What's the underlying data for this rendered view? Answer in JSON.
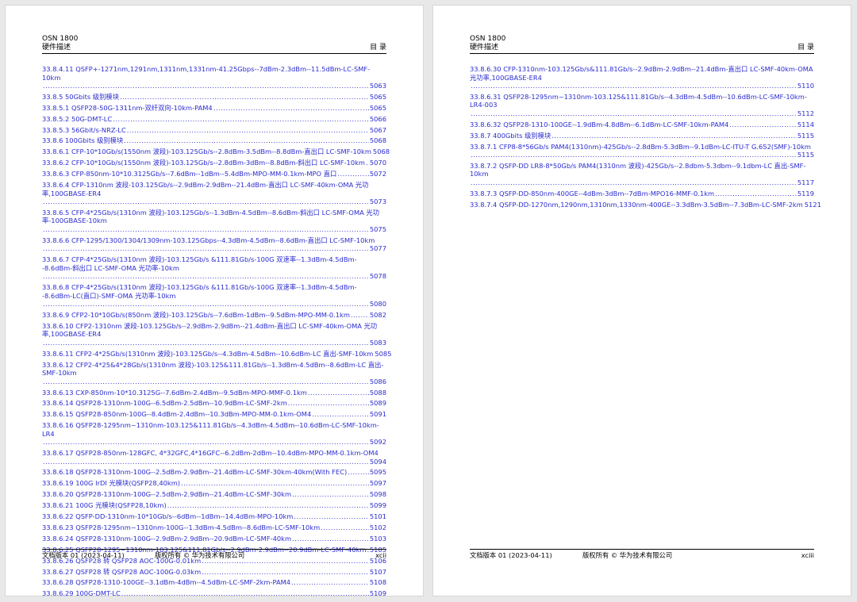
{
  "product": "OSN 1800",
  "doc_title": "硬件描述",
  "section": "目 录",
  "footer": {
    "version": "文档版本 01 (2023-04-11)",
    "copyright": "版权所有 © 华为技术有限公司"
  },
  "pages": [
    {
      "number": "xcii",
      "entries": [
        {
          "text": "33.8.4.11 QSFP+-1271nm,1291nm,1311nm,1331nm-41.25Gbps--7dBm-2.3dBm--11.5dBm-LC-SMF-10km",
          "page": "5063",
          "wrap": true
        },
        {
          "text": "33.8.5 50Gbits 级别模块",
          "page": "5065"
        },
        {
          "text": "33.8.5.1 QSFP28-50G-1311nm-双纤双向-10km-PAM4",
          "page": "5065"
        },
        {
          "text": "33.8.5.2 50G-DMT-LC",
          "page": "5066"
        },
        {
          "text": "33.8.5.3 56Gbit/s-NRZ-LC",
          "page": "5067"
        },
        {
          "text": "33.8.6 100Gbits 级别模块",
          "page": "5068"
        },
        {
          "text": "33.8.6.1 CFP-10*10Gb/s(1550nm 波段)-103.125Gb/s--2.8dBm-3.5dBm--8.8dBm-直出口 LC-SMF-10km",
          "page": "5068"
        },
        {
          "text": "33.8.6.2 CFP-10*10Gb/s(1550nm 波段)-103.125Gb/s--2.8dBm-3dBm--8.8dBm-斜出口 LC-SMF-10km",
          "page": "5070"
        },
        {
          "text": "33.8.6.3 CFP-850nm-10*10.3125Gb/s--7.6dBm--1dBm--5.4dBm-MPO-MM-0.1km-MPO 直口",
          "page": "5072"
        },
        {
          "text": "33.8.6.4 CFP-1310nm 波段-103.125Gb/s--2.9dBm-2.9dBm--21.4dBm-直出口 LC-SMF-40km-OMA 光功率,100GBASE-ER4",
          "page": "5073",
          "wrap": true
        },
        {
          "text": "33.8.6.5 CFP-4*25Gb/s(1310nm 波段)-103.125Gb/s--1.3dBm-4.5dBm--8.6dBm-斜出口 LC-SMF-OMA 光功率-100GBASE-10km",
          "page": "5075",
          "wrap": true
        },
        {
          "text": "33.8.6.6 CFP-1295/1300/1304/1309nm-103.125Gbps--4.3dBm-4.5dBm--8.6dBm-直出口 LC-SMF-10km",
          "page": "5077",
          "wrap": true
        },
        {
          "text": "33.8.6.7 CFP-4*25Gb/s(1310nm 波段)-103.125Gb/s &111.81Gb/s-100G 双速率--1.3dBm-4.5dBm--8.6dBm-斜出口 LC-SMF-OMA 光功率-10km",
          "page": "5078",
          "wrap": true
        },
        {
          "text": "33.8.6.8 CFP-4*25Gb/s(1310nm 波段)-103.125Gb/s &111.81Gb/s-100G 双速率--1.3dBm-4.5dBm--8.6dBm-LC(直口)-SMF-OMA 光功率-10km",
          "page": "5080",
          "wrap": true
        },
        {
          "text": "33.8.6.9 CFP2-10*10Gb/s(850nm 波段)-103.125Gb/s--7.6dBm-1dBm--9.5dBm-MPO-MM-0.1km",
          "page": "5082"
        },
        {
          "text": "33.8.6.10 CFP2-1310nm 波段-103.125Gb/s--2.9dBm-2.9dBm--21.4dBm-直出口 LC-SMF-40km-OMA 光功率,100GBASE-ER4",
          "page": "5083",
          "wrap": true
        },
        {
          "text": "33.8.6.11 CFP2-4*25Gb/s(1310nm 波段)-103.125Gb/s--4.3dBm-4.5dBm--10.6dBm-LC 直出-SMF-10km",
          "page": "5085"
        },
        {
          "text": "33.8.6.12 CFP2-4*25&4*28Gb/s(1310nm 波段)-103.125&111.81Gb/s--1.3dBm-4.5dBm--8.6dBm-LC 直出-SMF-10km",
          "page": "5086",
          "wrap": true
        },
        {
          "text": "33.8.6.13 CXP-850nm-10*10.3125G--7.6dBm-2.4dBm--9.5dBm-MPO-MMF-0.1km",
          "page": "5088"
        },
        {
          "text": "33.8.6.14 QSFP28-1310nm-100G--6.5dBm-2.5dBm--10.9dBm-LC-SMF-2km",
          "page": "5089"
        },
        {
          "text": "33.8.6.15 QSFP28-850nm-100G--8.4dBm-2.4dBm--10.3dBm-MPO-MM-0.1km-OM4",
          "page": "5091"
        },
        {
          "text": "33.8.6.16 QSFP28-1295nm~1310nm-103.125&111.81Gb/s--4.3dBm-4.5dBm--10.6dBm-LC-SMF-10km-LR4",
          "page": "5092",
          "wrap": true
        },
        {
          "text": "33.8.6.17 QSFP28-850nm-128GFC, 4*32GFC,4*16GFC--6.2dBm-2dBm--10.4dBm-MPO-MM-0.1km-OM4",
          "page": "5094",
          "wrap": true
        },
        {
          "text": "33.8.6.18 QSFP28-1310nm-100G--2.5dBm-2.9dBm--21.4dBm-LC-SMF-30km-40km(With FEC)",
          "page": "5095"
        },
        {
          "text": "33.8.6.19 100G IrDI 光模块(QSFP28,40km)",
          "page": "5097"
        },
        {
          "text": "33.8.6.20 QSFP28-1310nm-100G--2.5dBm-2.9dBm--21.4dBm-LC-SMF-30km",
          "page": "5098"
        },
        {
          "text": "33.8.6.21 100G 光模块(QSFP28,10km)",
          "page": "5099"
        },
        {
          "text": "33.8.6.22 QSFP-DD-1310nm-10*10Gb/s--6dBm--1dBm--14.4dBm-MPO-10km",
          "page": "5101"
        },
        {
          "text": "33.8.6.23 QSFP28-1295nm~1310nm-100G--1.3dBm-4.5dBm--8.6dBm-LC-SMF-10km",
          "page": "5102"
        },
        {
          "text": "33.8.6.24 QSFP28-1310nm-100G--2.9dBm-2.9dBm--20.9dBm-LC-SMF-40km",
          "page": "5103"
        },
        {
          "text": "33.8.6.25 QSFP28-1295~1310nm-103.125&111.81Gb/s--2.9dBm-2.9dBm--20.9dBm-LC-SMF-40km",
          "page": "5105"
        },
        {
          "text": "33.8.6.26 QSFP28 转 QSFP28 AOC-100G-0.01km",
          "page": "5106"
        },
        {
          "text": "33.8.6.27 QSFP28 转 QSFP28 AOC-100G-0.03km",
          "page": "5107"
        },
        {
          "text": "33.8.6.28 QSFP28-1310-100GE--3.1dBm-4dBm--4.5dBm-LC-SMF-2km-PAM4",
          "page": "5108"
        },
        {
          "text": "33.8.6.29 100G-DMT-LC",
          "page": "5109"
        }
      ]
    },
    {
      "number": "xciii",
      "entries": [
        {
          "text": "33.8.6.30 CFP-1310nm-103.125Gb/s&111.81Gb/s--2.9dBm-2.9dBm--21.4dBm-直出口 LC-SMF-40km-OMA 光功率,100GBASE-ER4",
          "page": "5110",
          "wrap": true
        },
        {
          "text": "33.8.6.31 QSFP28-1295nm~1310nm-103.125&111.81Gb/s--4.3dBm-4.5dBm--10.6dBm-LC-SMF-10km-LR4-003",
          "page": "5112",
          "wrap": true
        },
        {
          "text": "33.8.6.32 QSFP28-1310-100GE--1.9dBm-4.8dBm--6.1dBm-LC-SMF-10km-PAM4",
          "page": "5114"
        },
        {
          "text": "33.8.7 400Gbits 级别模块",
          "page": "5115"
        },
        {
          "text": "33.8.7.1 CFP8-8*56Gb/s PAM4(1310nm)-425Gb/s--2.8dBm-5.3dBm--9.1dBm-LC-ITU-T G.652(SMF)-10km",
          "page": "5115",
          "wrap": true
        },
        {
          "text": "33.8.7.2 QSFP-DD LR8-8*50Gb/s PAM4(1310nm 波段)-425Gb/s--2.8dbm-5.3dbm--9.1dbm-LC 直出-SMF-10km",
          "page": "5117",
          "wrap": true
        },
        {
          "text": "33.8.7.3 QSFP-DD-850nm-400GE--4dBm-3dBm--7dBm-MPO16-MMF-0.1km",
          "page": "5119"
        },
        {
          "text": "33.8.7.4 QSFP-DD-1270nm,1290nm,1310nm,1330nm-400GE--3.3dBm-3.5dBm--7.3dBm-LC-SMF-2km",
          "page": "5121"
        }
      ]
    }
  ]
}
